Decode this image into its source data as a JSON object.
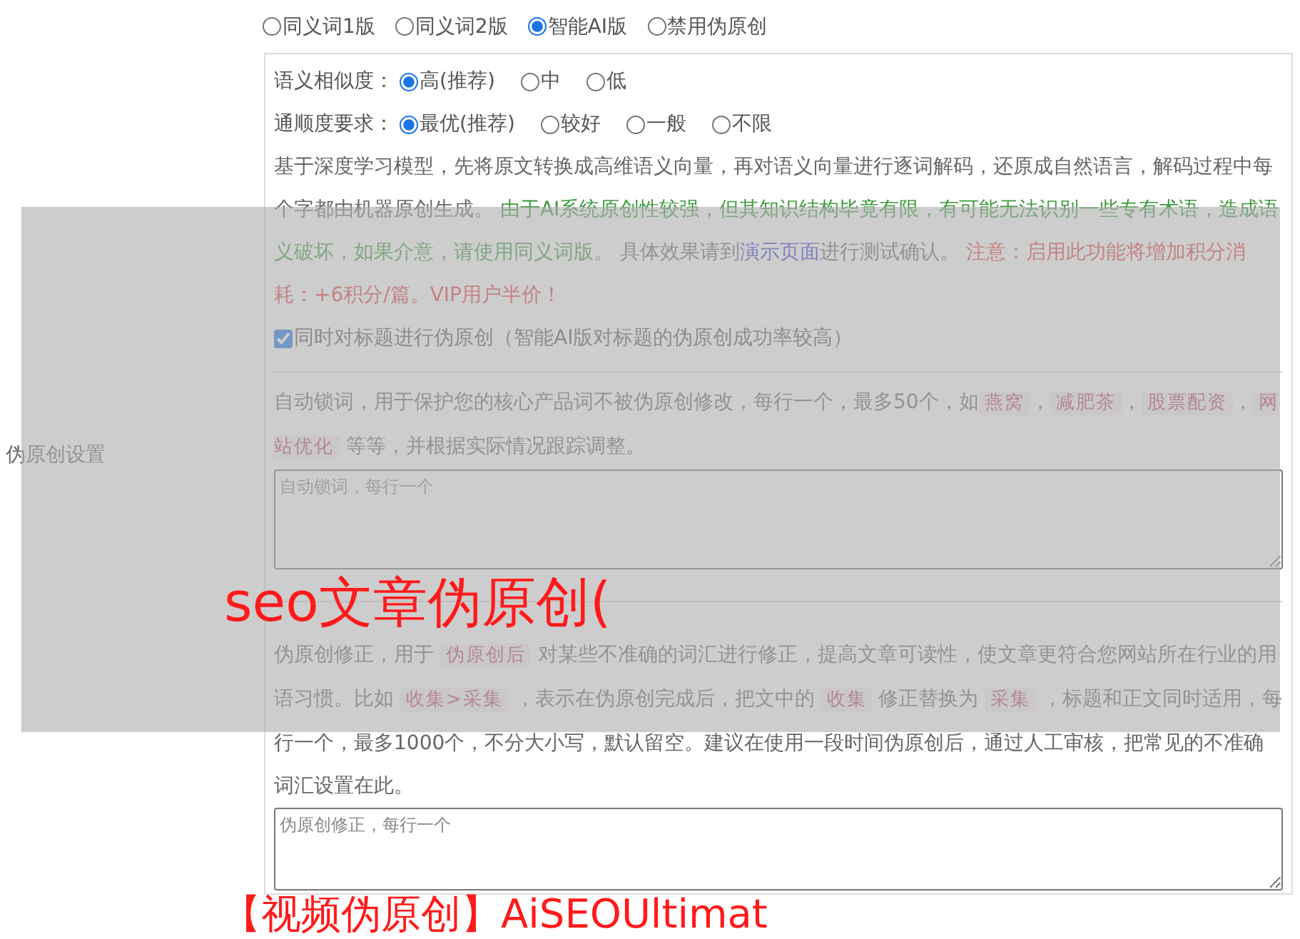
{
  "side_label": "伪原创设置",
  "modes": [
    {
      "label": "同义词1版",
      "selected": false
    },
    {
      "label": "同义词2版",
      "selected": false
    },
    {
      "label": "智能AI版",
      "selected": true
    },
    {
      "label": "禁用伪原创",
      "selected": false
    }
  ],
  "similarity": {
    "label": "语义相似度：",
    "options": [
      {
        "label": "高(推荐)",
        "selected": true
      },
      {
        "label": "中",
        "selected": false
      },
      {
        "label": "低",
        "selected": false
      }
    ]
  },
  "fluency": {
    "label": "通顺度要求：",
    "options": [
      {
        "label": "最优(推荐)",
        "selected": true
      },
      {
        "label": "较好",
        "selected": false
      },
      {
        "label": "一般",
        "selected": false
      },
      {
        "label": "不限",
        "selected": false
      }
    ]
  },
  "ai_description": [
    {
      "kind": "plain",
      "text": "基于深度学习模型，先将原文转换成高维语义向量，再对语义向量进行逐词解码，还原成自然语言，解码过程中每个字都由机器原创生成。 "
    },
    {
      "kind": "green",
      "text": "由于AI系统原创性较强，但其知识结构毕竟有限，有可能无法识别一些专有术语，造成语义破坏，如果介意，请使用同义词版。"
    },
    {
      "kind": "plain",
      "text": " 具体效果请到"
    },
    {
      "kind": "link",
      "text": "演示页面"
    },
    {
      "kind": "plain",
      "text": "进行测试确认。 "
    },
    {
      "kind": "red",
      "text": "注意：启用此功能将增加积分消耗：+6积分/篇。VIP用户半价！"
    }
  ],
  "title_option": {
    "label": "同时对标题进行伪原创（智能AI版对标题的伪原创成功率较高）",
    "checked": true
  },
  "lock_words": {
    "description": [
      {
        "kind": "plain",
        "text": "自动锁词，用于保护您的核心产品词不被伪原创修改，每行一个，最多50个，如"
      },
      {
        "kind": "code",
        "text": "燕窝"
      },
      {
        "kind": "plain",
        "text": "，"
      },
      {
        "kind": "code",
        "text": "减肥茶"
      },
      {
        "kind": "plain",
        "text": "，"
      },
      {
        "kind": "code",
        "text": "股票配资"
      },
      {
        "kind": "plain",
        "text": "，"
      },
      {
        "kind": "code",
        "text": "网站优化"
      },
      {
        "kind": "plain",
        "text": " 等等，并根据实际情况跟踪调整。"
      }
    ],
    "placeholder": "自动锁词，每行一个"
  },
  "correction": {
    "description": [
      {
        "kind": "plain",
        "text": "伪原创修正，用于 "
      },
      {
        "kind": "code",
        "text": "伪原创后"
      },
      {
        "kind": "plain",
        "text": " 对某些不准确的词汇进行修正，提高文章可读性，使文章更符合您网站所在行业的用语习惯。比如 "
      },
      {
        "kind": "code",
        "text": "收集>采集"
      },
      {
        "kind": "plain",
        "text": " ，表示在伪原创完成后，把文中的 "
      },
      {
        "kind": "code",
        "text": "收集"
      },
      {
        "kind": "plain",
        "text": " 修正替换为 "
      },
      {
        "kind": "code",
        "text": "采集"
      },
      {
        "kind": "plain",
        "text": " ，标题和正文同时适用，每行一个，最多1000个，不分大小写，默认留空。建议在使用一段时间伪原创后，通过人工审核，把常见的不准确词汇设置在此。"
      }
    ],
    "placeholder": "伪原创修正，每行一个"
  },
  "overlay": {
    "headline": "seo文章伪原创(",
    "footer_headline": "【视频伪原创】AiSEOUltimat"
  }
}
